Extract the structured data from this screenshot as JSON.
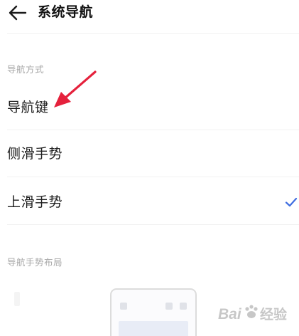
{
  "header": {
    "title": "系统导航",
    "back_icon": "arrow-left-icon"
  },
  "sections": {
    "nav_method": "导航方式",
    "gesture_layout": "导航手势布局"
  },
  "options": [
    {
      "label": "导航键",
      "selected": false
    },
    {
      "label": "侧滑手势",
      "selected": false
    },
    {
      "label": "上滑手势",
      "selected": true
    }
  ],
  "colors": {
    "accent_check": "#3f6de0",
    "annotation_arrow": "#e5213c",
    "section_text": "#a7a7a7"
  },
  "watermark": {
    "brand": "Bai",
    "suffix": "经验"
  }
}
